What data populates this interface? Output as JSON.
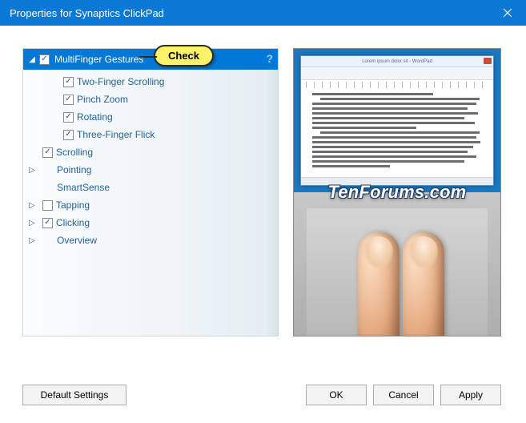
{
  "titlebar": {
    "title": "Properties for Synaptics ClickPad"
  },
  "callout": {
    "label": "Check"
  },
  "tree": {
    "header": {
      "label": "MultiFinger Gestures",
      "checked": true,
      "expanded": true
    },
    "children": [
      {
        "label": "Two-Finger Scrolling",
        "checked": true
      },
      {
        "label": "Pinch Zoom",
        "checked": true
      },
      {
        "label": "Rotating",
        "checked": true
      },
      {
        "label": "Three-Finger Flick",
        "checked": true
      }
    ],
    "top_items": [
      {
        "label": "Scrolling",
        "checkbox": true,
        "checked": true,
        "arrow": false
      },
      {
        "label": "Pointing",
        "checkbox": false,
        "arrow": true
      },
      {
        "label": "SmartSense",
        "checkbox": false,
        "arrow": false
      },
      {
        "label": "Tapping",
        "checkbox": true,
        "checked": false,
        "arrow": true
      },
      {
        "label": "Clicking",
        "checkbox": true,
        "checked": true,
        "arrow": true
      },
      {
        "label": "Overview",
        "checkbox": false,
        "arrow": true
      }
    ]
  },
  "preview": {
    "doc_title": "Lorem ipsum dolor sit - WordPad",
    "watermark": "TenForums.com"
  },
  "buttons": {
    "defaults": "Default Settings",
    "ok": "OK",
    "cancel": "Cancel",
    "apply": "Apply"
  }
}
